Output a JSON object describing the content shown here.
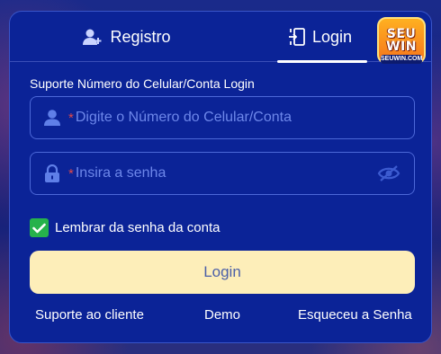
{
  "tabs": {
    "registro_label": "Registro",
    "login_label": "Login",
    "active": "Login"
  },
  "logo": {
    "line1": "SEU",
    "line2": "WIN",
    "line3": "SEUWIN.COM"
  },
  "form": {
    "support_label": "Suporte Número do Celular/Conta Login",
    "phone_placeholder": "Digite o Número do Celular/Conta",
    "phone_value": "",
    "password_placeholder": "Insira a senha",
    "password_value": "",
    "required_mark": "*",
    "remember_label": "Lembrar da senha da conta",
    "remember_checked": true,
    "submit_label": "Login"
  },
  "footer": {
    "support": "Suporte ao cliente",
    "demo": "Demo",
    "forgot": "Esqueceu a Senha"
  },
  "colors": {
    "panel_bg": "#0b2397",
    "accent_button": "#fdeeb9",
    "checkbox_green": "#26b24b",
    "required_red": "#e04848",
    "placeholder": "#6d87ea"
  },
  "icons": [
    "user-add-icon",
    "login-door-icon",
    "user-icon",
    "lock-icon",
    "eye-off-icon",
    "check-icon"
  ]
}
